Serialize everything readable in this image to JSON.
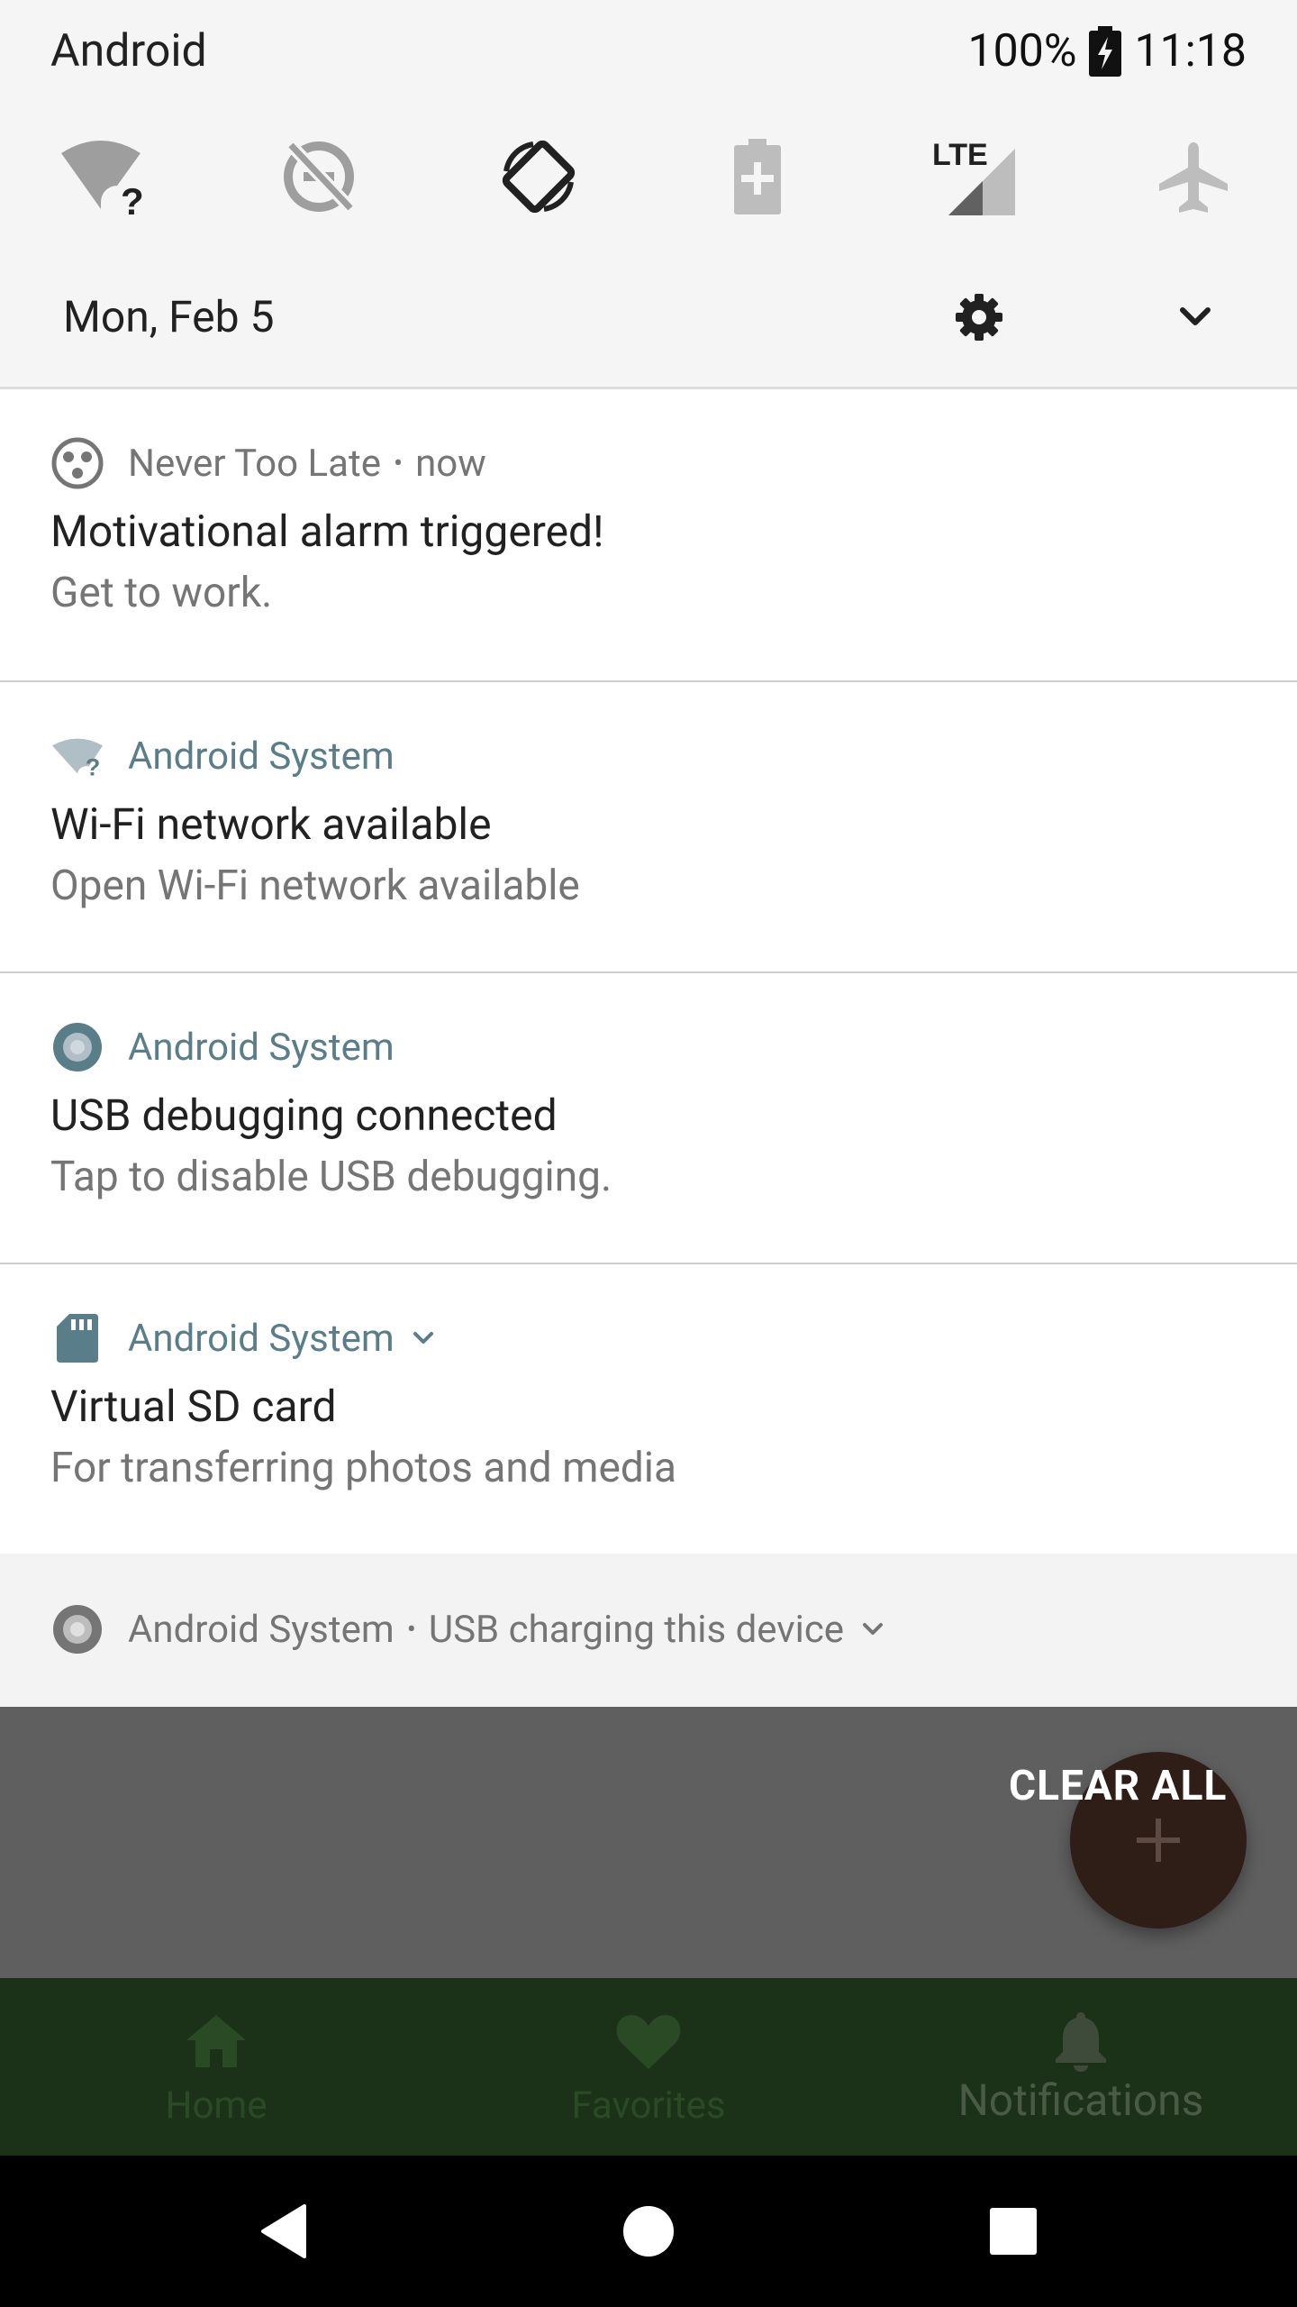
{
  "status_bar": {
    "carrier": "Android",
    "battery_percent": "100%",
    "time": "11:18"
  },
  "quick_settings": {
    "tiles": [
      {
        "name": "wifi-unknown-icon"
      },
      {
        "name": "data-saver-off-icon"
      },
      {
        "name": "auto-rotate-icon"
      },
      {
        "name": "battery-saver-icon"
      },
      {
        "name": "lte-signal-icon",
        "text": "LTE"
      },
      {
        "name": "airplane-mode-icon"
      }
    ],
    "date": "Mon, Feb 5"
  },
  "notifications": [
    {
      "app": "Never Too Late",
      "time": "now",
      "title": "Motivational alarm triggered!",
      "text": "Get to work."
    },
    {
      "app": "Android System",
      "title": "Wi-Fi network available",
      "text": "Open Wi-Fi network available"
    },
    {
      "app": "Android System",
      "title": "USB debugging connected",
      "text": "Tap to disable USB debugging."
    },
    {
      "app": "Android System",
      "title": "Virtual SD card",
      "text": "For transferring photos and media"
    },
    {
      "app": "Android System",
      "subtext": "USB charging this device"
    }
  ],
  "clear_all_label": "CLEAR ALL",
  "bottom_nav": {
    "items": [
      {
        "label": "Home"
      },
      {
        "label": "Favorites"
      },
      {
        "label": "Notifications"
      }
    ]
  },
  "colors": {
    "shade_bg": "#f5f5f5",
    "notification_bg": "#ffffff",
    "app_name_teal": "#5a7d8a",
    "scrim": "#5f5f5f",
    "fab": "#2f1d17",
    "bottom_nav_bg": "#1b3219",
    "system_nav_bg": "#000000"
  }
}
